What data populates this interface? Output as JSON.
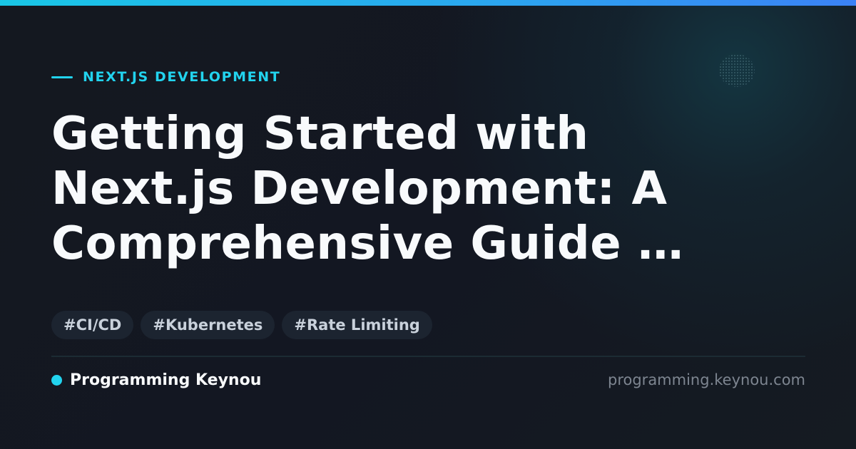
{
  "colors": {
    "background": "#13161f",
    "accent": "#22d3ee",
    "title": "#f8fafc",
    "tag_background": "#1c2430",
    "tag_text": "#c9d1db",
    "muted_text": "#7d8590"
  },
  "category": {
    "label": "NEXT.JS DEVELOPMENT"
  },
  "title": {
    "line1": "Getting Started with",
    "line2": "Next.js Development: A",
    "line3": "Comprehensive Guide …"
  },
  "tags": [
    {
      "label": "#CI/CD"
    },
    {
      "label": "#Kubernetes"
    },
    {
      "label": "#Rate Limiting"
    }
  ],
  "footer": {
    "brand": "Programming Keynou",
    "domain": "programming.keynou.com"
  }
}
